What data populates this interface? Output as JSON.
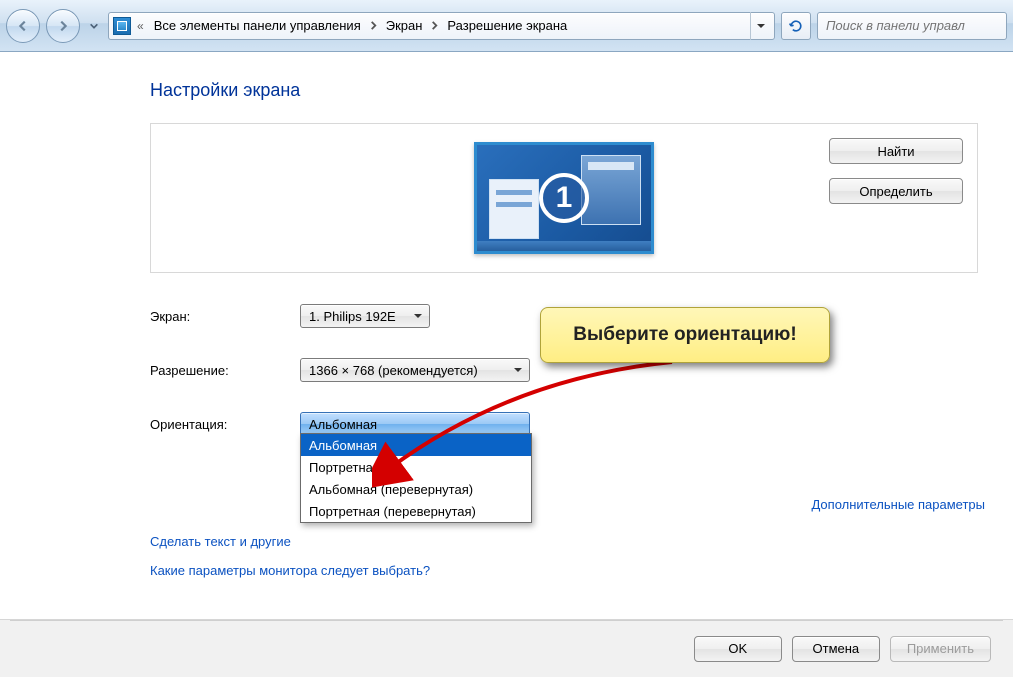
{
  "breadcrumb": {
    "root": "Все элементы панели управления",
    "level1": "Экран",
    "level2": "Разрешение экрана"
  },
  "search": {
    "placeholder": "Поиск в панели управл"
  },
  "title": "Настройки экрана",
  "monitor_number": "1",
  "buttons": {
    "find": "Найти",
    "detect": "Определить",
    "ok": "OK",
    "cancel": "Отмена",
    "apply": "Применить"
  },
  "labels": {
    "display": "Экран:",
    "resolution": "Разрешение:",
    "orientation": "Ориентация:"
  },
  "values": {
    "display": "1. Philips 192E",
    "resolution": "1366 × 768 (рекомендуется)",
    "orientation": "Альбомная"
  },
  "orientation_options": [
    "Альбомная",
    "Портретная",
    "Альбомная (перевернутая)",
    "Портретная (перевернутая)"
  ],
  "links": {
    "advanced": "Дополнительные параметры",
    "text_size": "Сделать текст и другие",
    "which_settings": "Какие параметры монитора следует выбрать?"
  },
  "callout": "Выберите ориентацию!"
}
